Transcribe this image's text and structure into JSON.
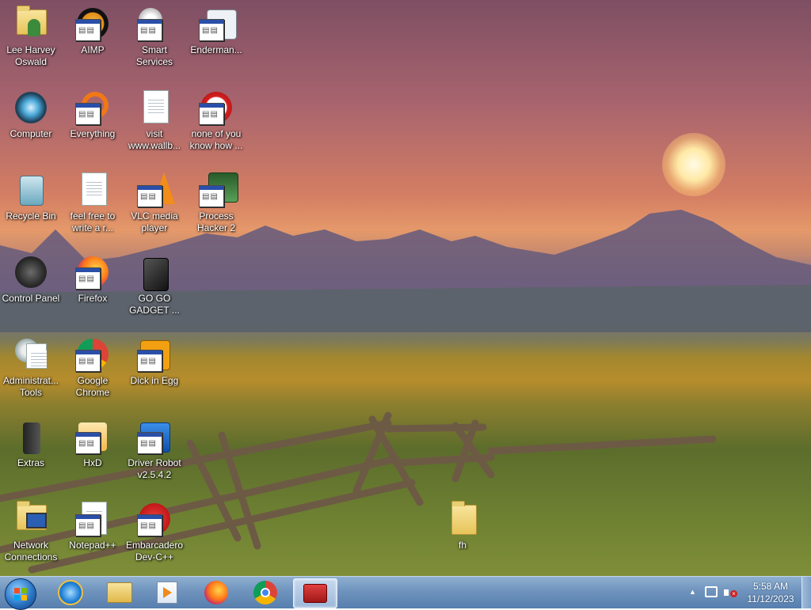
{
  "desktop": {
    "icons": [
      {
        "label": "Lee Harvey\nOswald"
      },
      {
        "label": "AIMP"
      },
      {
        "label": "Smart\nServices"
      },
      {
        "label": "Enderman..."
      },
      {
        "label": "Computer"
      },
      {
        "label": "Everything"
      },
      {
        "label": "visit\nwww.wallb..."
      },
      {
        "label": "none of you\nknow how ..."
      },
      {
        "label": "Recycle Bin"
      },
      {
        "label": "feel free to\nwrite a r..."
      },
      {
        "label": "VLC media\nplayer"
      },
      {
        "label": "Process\nHacker 2"
      },
      {
        "label": "Control Panel"
      },
      {
        "label": "Firefox"
      },
      {
        "label": "GO GO\nGADGET ..."
      },
      {
        "label": "Administrat...\nTools"
      },
      {
        "label": "Google\nChrome"
      },
      {
        "label": "Dick in Egg"
      },
      {
        "label": "Extras"
      },
      {
        "label": "HxD"
      },
      {
        "label": "Driver Robot\nv2.5.4.2"
      },
      {
        "label": "Network\nConnections"
      },
      {
        "label": "Notepad++"
      },
      {
        "label": "Embarcadero\nDev-C++"
      },
      {
        "label": "fh"
      }
    ]
  },
  "taskbar": {
    "pinned": [
      "start-button",
      "internet-explorer",
      "file-explorer",
      "media-player",
      "firefox",
      "google-chrome",
      "toolbox-app"
    ],
    "tray_arrow": "▲",
    "clock": {
      "time": "5:58 AM",
      "date": "11/12/2023"
    }
  }
}
